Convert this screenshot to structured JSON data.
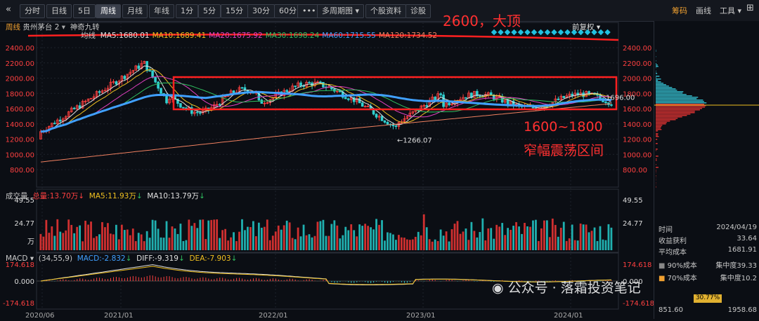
{
  "toolbar": {
    "back_icon": "«",
    "tabs": [
      "分时",
      "日线",
      "5日",
      "周线",
      "月线",
      "年线",
      "1分",
      "5分",
      "15分",
      "30分",
      "60分"
    ],
    "active_tab": "周线",
    "more": "•••",
    "multi_period": "多周期图",
    "stock_info": "个股资料",
    "diagnose": "诊股",
    "right": [
      "筹码",
      "画线",
      "工具"
    ],
    "active_right": "筹码"
  },
  "main_panel": {
    "period_label": "周线",
    "stock_name": "贵州茅台",
    "multiplier": "2",
    "indicator_name": "神奇九转",
    "ma_label": "均线",
    "ma_values": [
      {
        "label": "MA5:1680.01",
        "color": "#e0e0e0"
      },
      {
        "label": "MA10:1689.41",
        "color": "#f0c020"
      },
      {
        "label": "MA20:1675.92",
        "color": "#e040c0"
      },
      {
        "label": "MA30:1698.24",
        "color": "#30c060"
      },
      {
        "label": "MA60:1715.55",
        "color": "#40a0ff"
      },
      {
        "label": "MA120:1734.52",
        "color": "#f08060"
      }
    ],
    "fq_label": "前复权",
    "y_ticks": [
      "2400.00",
      "2200.00",
      "2000.00",
      "1800.00",
      "1600.00",
      "1400.00",
      "1200.00",
      "1000.00",
      "800.00"
    ],
    "right_ticks": [
      "2400.00",
      "2200.00",
      "2000.00",
      "1800.00",
      "1600.00",
      "1400.00",
      "1200.00",
      "1000.00",
      "800.00"
    ],
    "last_price": "1696.00",
    "low_label": "←1266.07",
    "annotation_top": "2600，大顶",
    "annotation_mid1": "1600~1800",
    "annotation_mid2": "窄幅震荡区间"
  },
  "volume_panel": {
    "title": "成交量",
    "total": "总量:13.70万",
    "ma5": "MA5:11.93万",
    "ma10": "MA10:13.79万",
    "ticks": [
      "49.55",
      "24.77",
      "万"
    ]
  },
  "macd_panel": {
    "title": "MACD",
    "params": "(34,55,9)",
    "macd": "MACD:-2.832",
    "diff": "DIFF:-9.319",
    "dea": "DEA:-7.903",
    "ticks": [
      "174.618",
      "0.000",
      "-174.618"
    ]
  },
  "x_axis": [
    "2020/06",
    "2021/01",
    "2022/01",
    "2023/01",
    "2024/01"
  ],
  "side_panel": {
    "time_label": "时间",
    "time_value": "2024/04/19",
    "profit_label": "收益获利",
    "profit_value": "33.64",
    "avg_label": "平均成本",
    "avg_value": "1681.91",
    "c90_label": "90%成本",
    "c90_conc": "集中度39.33",
    "c70_label": "70%成本",
    "c70_conc": "集中度10.2",
    "range_low": "851.60",
    "range_high": "1958.68",
    "pct": "30.77%"
  },
  "watermark": "公众号 · 落霜投资笔记",
  "chart_data": {
    "type": "candlestick",
    "title": "贵州茅台 周线",
    "x": [
      "2020/06",
      "2021/01",
      "2022/01",
      "2023/01",
      "2024/01"
    ],
    "ylim": [
      800,
      2600
    ],
    "series": [
      {
        "name": "MA5",
        "values": [
          1680.01
        ]
      },
      {
        "name": "MA10",
        "values": [
          1689.41
        ]
      },
      {
        "name": "MA20",
        "values": [
          1675.92
        ]
      },
      {
        "name": "MA30",
        "values": [
          1698.24
        ]
      },
      {
        "name": "MA60",
        "values": [
          1715.55
        ]
      },
      {
        "name": "MA120",
        "values": [
          1734.52
        ]
      }
    ],
    "annotations": [
      "2600，大顶",
      "1600~1800",
      "窄幅震荡区间",
      "←1266.07"
    ],
    "last_price": 1696.0
  }
}
